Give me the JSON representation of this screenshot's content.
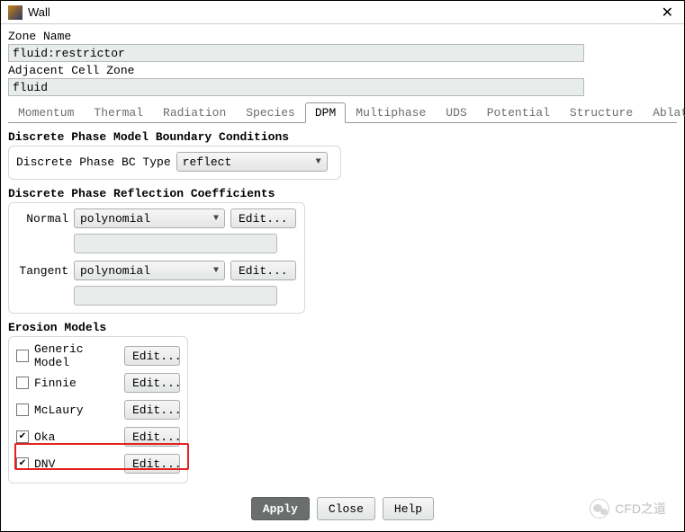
{
  "window": {
    "title": "Wall"
  },
  "zone": {
    "label": "Zone Name",
    "value": "fluid:restrictor",
    "adj_label": "Adjacent Cell Zone",
    "adj_value": "fluid"
  },
  "tabs": [
    "Momentum",
    "Thermal",
    "Radiation",
    "Species",
    "DPM",
    "Multiphase",
    "UDS",
    "Potential",
    "Structure",
    "Ablation"
  ],
  "active_tab": "DPM",
  "dpm_bc": {
    "section_title": "Discrete Phase Model Boundary Conditions",
    "type_label": "Discrete Phase BC Type",
    "type_value": "reflect"
  },
  "reflect": {
    "section_title": "Discrete Phase Reflection Coefficients",
    "normal_label": "Normal",
    "normal_value": "polynomial",
    "tangent_label": "Tangent",
    "tangent_value": "polynomial",
    "edit": "Edit..."
  },
  "erosion": {
    "section_title": "Erosion Models",
    "models": [
      {
        "label": "Generic Model",
        "checked": false
      },
      {
        "label": "Finnie",
        "checked": false
      },
      {
        "label": "McLaury",
        "checked": false
      },
      {
        "label": "Oka",
        "checked": true
      },
      {
        "label": "DNV",
        "checked": true
      }
    ],
    "edit": "Edit..."
  },
  "footer": {
    "apply": "Apply",
    "close": "Close",
    "help": "Help"
  },
  "watermark": "CFD之道"
}
